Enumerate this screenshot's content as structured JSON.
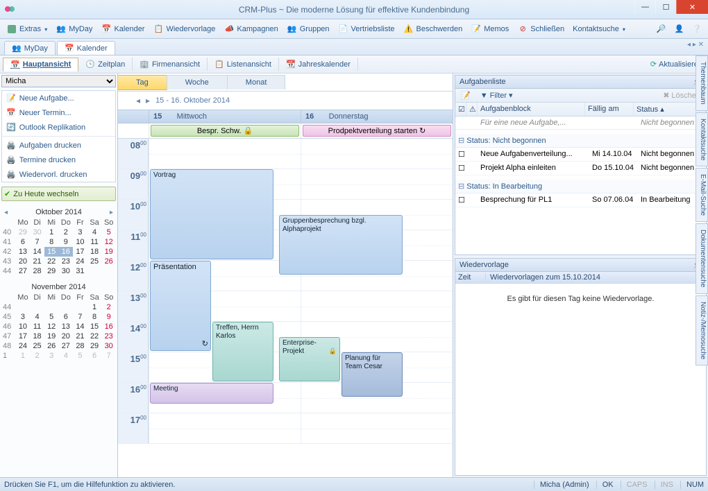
{
  "window": {
    "title": "CRM-Plus ~ Die moderne Lösung für effektive Kundenbindung"
  },
  "toolbar": {
    "extras": "Extras",
    "myday": "MyDay",
    "kalender": "Kalender",
    "wiedervorlage": "Wiedervorlage",
    "kampagnen": "Kampagnen",
    "gruppen": "Gruppen",
    "vertriebsliste": "Vertriebsliste",
    "beschwerden": "Beschwerden",
    "memos": "Memos",
    "schliessen": "Schließen",
    "kontaktsuche": "Kontaktsuche"
  },
  "tabs": {
    "myday": "MyDay",
    "kalender": "Kalender"
  },
  "viewtabs": {
    "haupt": "Hauptansicht",
    "zeitplan": "Zeitplan",
    "firmen": "Firmenansicht",
    "listen": "Listenansicht",
    "jahres": "Jahreskalender",
    "refresh": "Aktualisieren"
  },
  "left": {
    "user": "Micha",
    "actions": {
      "neue_aufgabe": "Neue Aufgabe...",
      "neuer_termin": "Neuer Termin...",
      "outlook": "Outlook Replikation",
      "aufgaben_drucken": "Aufgaben drucken",
      "termine_drucken": "Termine drucken",
      "wiedervorl_drucken": "Wiedervorl. drucken"
    },
    "today_btn": "Zu Heute wechseln",
    "cal1": {
      "title": "Oktober 2014"
    },
    "cal2": {
      "title": "November 2014"
    }
  },
  "center": {
    "range": {
      "tag": "Tag",
      "woche": "Woche",
      "monat": "Monat"
    },
    "daterange": "15 - 16. Oktober 2014",
    "day1_num": "15",
    "day1_name": "Mittwoch",
    "day2_num": "16",
    "day2_name": "Donnerstag",
    "allday1": "Bespr. Schw.",
    "allday2": "Prodpektverteilung starten",
    "hours": [
      "08",
      "09",
      "10",
      "11",
      "12",
      "13",
      "14",
      "15",
      "16",
      "17"
    ],
    "events": {
      "vortrag": "Vortrag",
      "praesentation": "Präsentation",
      "treffen": "Treffen, Herrn Karlos",
      "meeting": "Meeting",
      "gruppe": "Gruppenbesprechung bzgl. Alphaprojekt",
      "enterprise": "Enterprise-Projekt",
      "planung": "Planung für Team Cesar"
    }
  },
  "right": {
    "aufgaben": {
      "title": "Aufgabenliste",
      "filter": "Filter",
      "loeschen": "Löschen",
      "col1": "Aufgabenblock",
      "col2": "Fällig am",
      "col3": "Status",
      "newrow": "Für eine neue Aufgabe,...",
      "newrow_status": "Nicht begonnen",
      "group1": "Status: Nicht begonnen",
      "r1_name": "Neue Aufgabenverteilung...",
      "r1_date": "Mi 14.10.04",
      "r1_status": "Nicht begonnen",
      "r2_name": "Projekt Alpha einleiten",
      "r2_date": "Do 15.10.04",
      "r2_status": "Nicht begonnen",
      "group2": "Status: In Bearbeitung",
      "r3_name": "Besprechung für PL1",
      "r3_date": "So 07.06.04",
      "r3_status": "In Bearbeitung"
    },
    "wv": {
      "title": "Wiedervorlage",
      "zeit_lbl": "Zeit",
      "zeit_val": "Wiedervorlagen zum 15.10.2014",
      "empty": "Es gibt für diesen Tag keine Wiedervorlage."
    }
  },
  "sidetabs": {
    "t1": "Themenbaum",
    "t2": "Kontaktsuche",
    "t3": "E-Mail-Suche",
    "t4": "Dokumentensuche",
    "t5": "Notiz-/Memosuche"
  },
  "status": {
    "help": "Drücken Sie F1, um die Hilfefunktion zu aktivieren.",
    "user": "Micha (Admin)",
    "ok": "OK",
    "caps": "CAPS",
    "ins": "INS",
    "num": "NUM"
  }
}
